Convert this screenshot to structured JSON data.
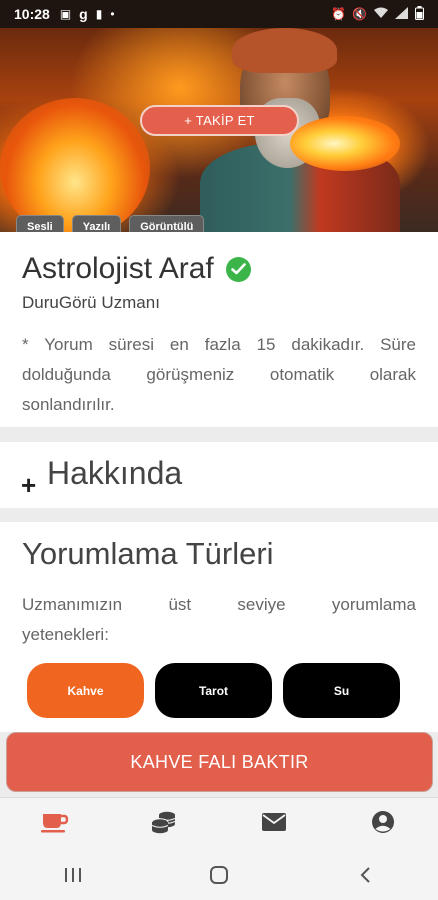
{
  "status_bar": {
    "time": "10:28"
  },
  "hero": {
    "follow_label": "+ TAKİP ET",
    "media_tags": [
      "Sesli",
      "Yazılı",
      "Görüntülü"
    ]
  },
  "profile": {
    "name": "Astrolojist Araf",
    "title": "DuruGörü Uzmanı",
    "note": "* Yorum süresi en fazla 15 dakikadır. Süre dolduğunda görüşmeniz otomatik olarak sonlandırılır."
  },
  "about": {
    "plus": "+",
    "title": "Hakkında"
  },
  "types": {
    "title": "Yorumlama Türleri",
    "desc_words": [
      "Uzmanımızın",
      "üst",
      "seviye",
      "yorumlama"
    ],
    "desc_line2": "yetenekleri:",
    "buttons": [
      {
        "label": "Kahve",
        "active": true
      },
      {
        "label": "Tarot",
        "active": false
      },
      {
        "label": "Su",
        "active": false
      }
    ]
  },
  "cta": {
    "label": "KAHVE FALI BAKTIR"
  },
  "bottom_nav": {
    "items": [
      {
        "icon": "coffee-cup-icon",
        "active": true
      },
      {
        "icon": "coins-icon",
        "active": false
      },
      {
        "icon": "envelope-icon",
        "active": false
      },
      {
        "icon": "user-circle-icon",
        "active": false
      }
    ]
  },
  "colors": {
    "accent": "#e25f4c",
    "active_type": "#f0651f",
    "verified": "#3bb54a",
    "nav_active": "#e25f4c"
  }
}
